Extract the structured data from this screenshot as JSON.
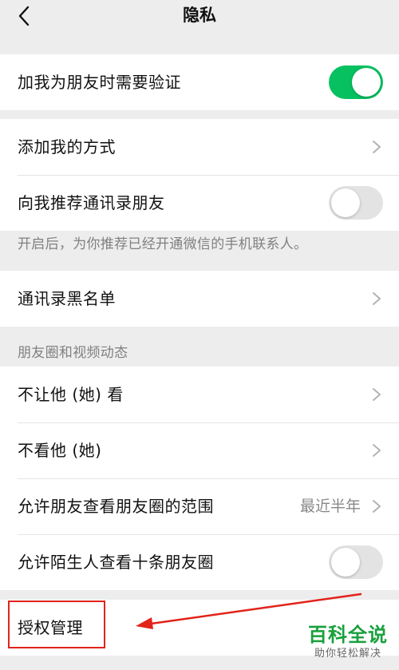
{
  "nav": {
    "title": "隐私",
    "back_icon": "chevron-left-icon"
  },
  "group1": {
    "verify_label": "加我为朋友时需要验证",
    "verify_toggle": true
  },
  "group2": {
    "add_ways_label": "添加我的方式",
    "recommend_label": "向我推荐通讯录朋友",
    "recommend_toggle": false
  },
  "recommend_note": "开启后，为你推荐已经开通微信的手机联系人。",
  "group3": {
    "blacklist_label": "通讯录黑名单"
  },
  "moments_section_title": "朋友圈和视频动态",
  "group4": {
    "hide_from_label": "不让他 (她) 看",
    "dont_see_label": "不看他 (她)",
    "range_label": "允许朋友查看朋友圈的范围",
    "range_value": "最近半年",
    "strangers_label": "允许陌生人查看十条朋友圈",
    "strangers_toggle": false
  },
  "group5": {
    "authorization_label": "授权管理"
  },
  "watermark": {
    "main": "百科全说",
    "sub": "助你轻松解决"
  },
  "colors": {
    "accent_green": "#07c160",
    "annotation_red": "#e2231a",
    "watermark_green": "#19a03c"
  }
}
